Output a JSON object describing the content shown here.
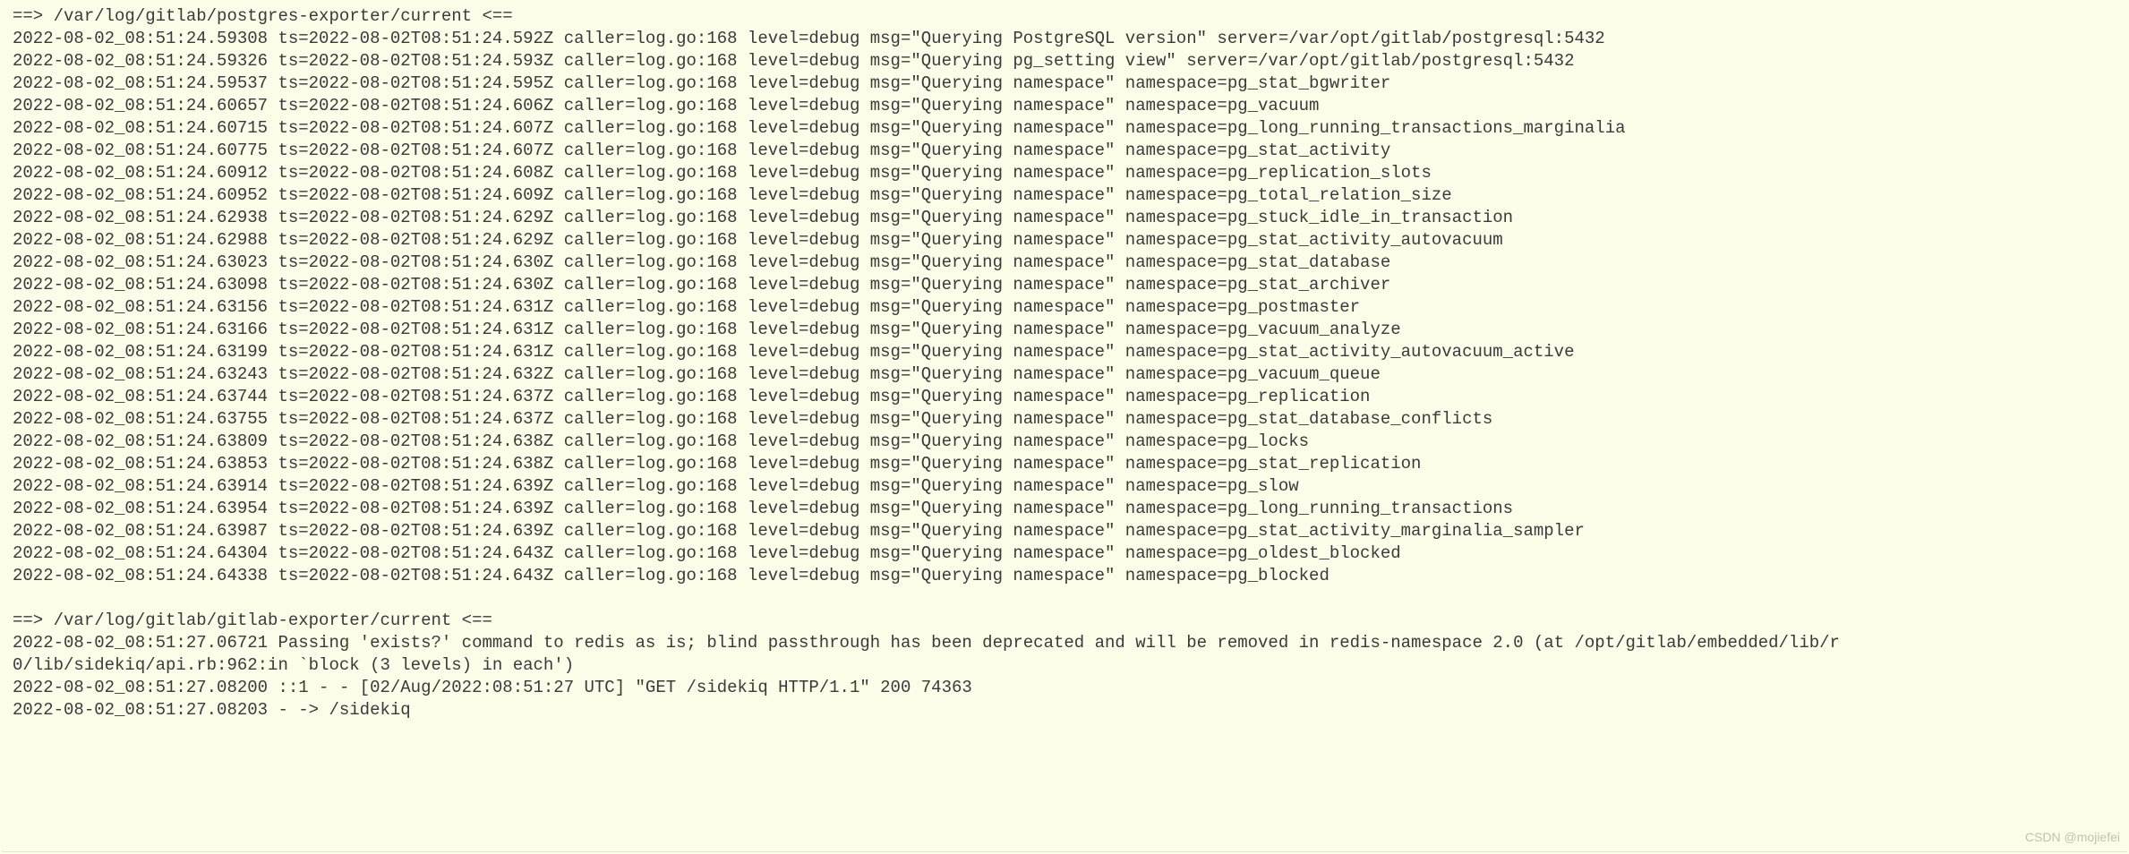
{
  "sections": [
    {
      "header": "==> /var/log/gitlab/postgres-exporter/current <==",
      "lines": [
        "2022-08-02_08:51:24.59308 ts=2022-08-02T08:51:24.592Z caller=log.go:168 level=debug msg=\"Querying PostgreSQL version\" server=/var/opt/gitlab/postgresql:5432",
        "2022-08-02_08:51:24.59326 ts=2022-08-02T08:51:24.593Z caller=log.go:168 level=debug msg=\"Querying pg_setting view\" server=/var/opt/gitlab/postgresql:5432",
        "2022-08-02_08:51:24.59537 ts=2022-08-02T08:51:24.595Z caller=log.go:168 level=debug msg=\"Querying namespace\" namespace=pg_stat_bgwriter",
        "2022-08-02_08:51:24.60657 ts=2022-08-02T08:51:24.606Z caller=log.go:168 level=debug msg=\"Querying namespace\" namespace=pg_vacuum",
        "2022-08-02_08:51:24.60715 ts=2022-08-02T08:51:24.607Z caller=log.go:168 level=debug msg=\"Querying namespace\" namespace=pg_long_running_transactions_marginalia",
        "2022-08-02_08:51:24.60775 ts=2022-08-02T08:51:24.607Z caller=log.go:168 level=debug msg=\"Querying namespace\" namespace=pg_stat_activity",
        "2022-08-02_08:51:24.60912 ts=2022-08-02T08:51:24.608Z caller=log.go:168 level=debug msg=\"Querying namespace\" namespace=pg_replication_slots",
        "2022-08-02_08:51:24.60952 ts=2022-08-02T08:51:24.609Z caller=log.go:168 level=debug msg=\"Querying namespace\" namespace=pg_total_relation_size",
        "2022-08-02_08:51:24.62938 ts=2022-08-02T08:51:24.629Z caller=log.go:168 level=debug msg=\"Querying namespace\" namespace=pg_stuck_idle_in_transaction",
        "2022-08-02_08:51:24.62988 ts=2022-08-02T08:51:24.629Z caller=log.go:168 level=debug msg=\"Querying namespace\" namespace=pg_stat_activity_autovacuum",
        "2022-08-02_08:51:24.63023 ts=2022-08-02T08:51:24.630Z caller=log.go:168 level=debug msg=\"Querying namespace\" namespace=pg_stat_database",
        "2022-08-02_08:51:24.63098 ts=2022-08-02T08:51:24.630Z caller=log.go:168 level=debug msg=\"Querying namespace\" namespace=pg_stat_archiver",
        "2022-08-02_08:51:24.63156 ts=2022-08-02T08:51:24.631Z caller=log.go:168 level=debug msg=\"Querying namespace\" namespace=pg_postmaster",
        "2022-08-02_08:51:24.63166 ts=2022-08-02T08:51:24.631Z caller=log.go:168 level=debug msg=\"Querying namespace\" namespace=pg_vacuum_analyze",
        "2022-08-02_08:51:24.63199 ts=2022-08-02T08:51:24.631Z caller=log.go:168 level=debug msg=\"Querying namespace\" namespace=pg_stat_activity_autovacuum_active",
        "2022-08-02_08:51:24.63243 ts=2022-08-02T08:51:24.632Z caller=log.go:168 level=debug msg=\"Querying namespace\" namespace=pg_vacuum_queue",
        "2022-08-02_08:51:24.63744 ts=2022-08-02T08:51:24.637Z caller=log.go:168 level=debug msg=\"Querying namespace\" namespace=pg_replication",
        "2022-08-02_08:51:24.63755 ts=2022-08-02T08:51:24.637Z caller=log.go:168 level=debug msg=\"Querying namespace\" namespace=pg_stat_database_conflicts",
        "2022-08-02_08:51:24.63809 ts=2022-08-02T08:51:24.638Z caller=log.go:168 level=debug msg=\"Querying namespace\" namespace=pg_locks",
        "2022-08-02_08:51:24.63853 ts=2022-08-02T08:51:24.638Z caller=log.go:168 level=debug msg=\"Querying namespace\" namespace=pg_stat_replication",
        "2022-08-02_08:51:24.63914 ts=2022-08-02T08:51:24.639Z caller=log.go:168 level=debug msg=\"Querying namespace\" namespace=pg_slow",
        "2022-08-02_08:51:24.63954 ts=2022-08-02T08:51:24.639Z caller=log.go:168 level=debug msg=\"Querying namespace\" namespace=pg_long_running_transactions",
        "2022-08-02_08:51:24.63987 ts=2022-08-02T08:51:24.639Z caller=log.go:168 level=debug msg=\"Querying namespace\" namespace=pg_stat_activity_marginalia_sampler",
        "2022-08-02_08:51:24.64304 ts=2022-08-02T08:51:24.643Z caller=log.go:168 level=debug msg=\"Querying namespace\" namespace=pg_oldest_blocked",
        "2022-08-02_08:51:24.64338 ts=2022-08-02T08:51:24.643Z caller=log.go:168 level=debug msg=\"Querying namespace\" namespace=pg_blocked"
      ]
    },
    {
      "header": "==> /var/log/gitlab/gitlab-exporter/current <==",
      "lines": [
        "2022-08-02_08:51:27.06721 Passing 'exists?' command to redis as is; blind passthrough has been deprecated and will be removed in redis-namespace 2.0 (at /opt/gitlab/embedded/lib/r",
        "0/lib/sidekiq/api.rb:962:in `block (3 levels) in each')",
        "2022-08-02_08:51:27.08200 ::1 - - [02/Aug/2022:08:51:27 UTC] \"GET /sidekiq HTTP/1.1\" 200 74363",
        "2022-08-02_08:51:27.08203 - -> /sidekiq"
      ]
    }
  ],
  "watermark": "CSDN @mojiefei"
}
